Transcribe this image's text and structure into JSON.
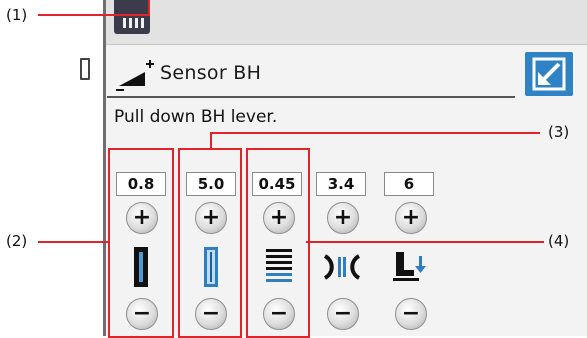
{
  "header": {
    "mode_title": "Sensor BH"
  },
  "instruction": "Pull down BH lever.",
  "settings": [
    {
      "value": "0.8",
      "plus": "+",
      "minus": "−",
      "icon": "buttonhole-width-icon"
    },
    {
      "value": "5.0",
      "plus": "+",
      "minus": "−",
      "icon": "stitch-width-icon"
    },
    {
      "value": "0.45",
      "plus": "+",
      "minus": "−",
      "icon": "stitch-length-icon"
    },
    {
      "value": "3.4",
      "plus": "+",
      "minus": "−",
      "icon": "tension-icon"
    },
    {
      "value": "6",
      "plus": "+",
      "minus": "−",
      "icon": "presser-foot-height-icon"
    }
  ],
  "callouts": {
    "c1": "(1)",
    "c2": "(2)",
    "c3": "(3)",
    "c4": "(4)"
  },
  "colors": {
    "callout": "#e0242c",
    "accent": "#2f83c4"
  }
}
